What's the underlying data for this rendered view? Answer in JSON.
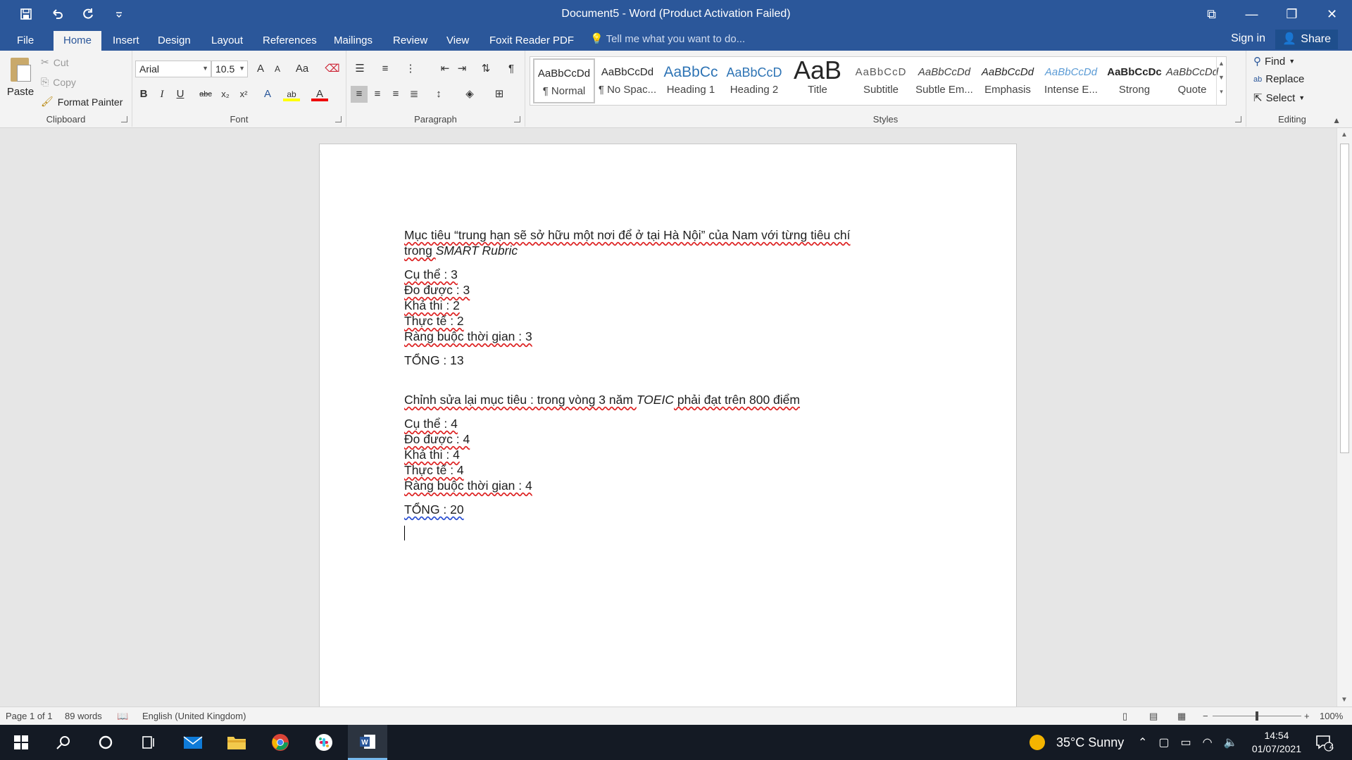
{
  "window": {
    "title": "Document5 - Word (Product Activation Failed)",
    "controls": [
      "⧉",
      "—",
      "❐",
      "✕"
    ]
  },
  "qat": {
    "icons": [
      "save-icon",
      "undo-icon",
      "redo-icon",
      "customize-icon"
    ]
  },
  "tabs": [
    "File",
    "Home",
    "Insert",
    "Design",
    "Layout",
    "References",
    "Mailings",
    "Review",
    "View",
    "Foxit Reader PDF"
  ],
  "active_tab": "Home",
  "tell_me": "Tell me what you want to do...",
  "account": {
    "sign_in": "Sign in",
    "share": "Share"
  },
  "clipboard": {
    "paste": "Paste",
    "cut": "Cut",
    "copy": "Copy",
    "format_painter": "Format Painter",
    "label": "Clipboard"
  },
  "font": {
    "family": "Arial",
    "size": "10.5",
    "label": "Font",
    "case_btn": "Aa",
    "grow": "A",
    "shrink": "A"
  },
  "paragraph": {
    "label": "Paragraph"
  },
  "styles": {
    "label": "Styles",
    "items": [
      {
        "sample": "AaBbCcDd",
        "name": "¶ Normal"
      },
      {
        "sample": "AaBbCcDd",
        "name": "¶ No Spac..."
      },
      {
        "sample": "AaBbCc",
        "name": "Heading 1"
      },
      {
        "sample": "AaBbCcD",
        "name": "Heading 2"
      },
      {
        "sample": "AaB",
        "name": "Title"
      },
      {
        "sample": "AaBbCcD",
        "name": "Subtitle"
      },
      {
        "sample": "AaBbCcDd",
        "name": "Subtle Em..."
      },
      {
        "sample": "AaBbCcDd",
        "name": "Emphasis"
      },
      {
        "sample": "AaBbCcDd",
        "name": "Intense E..."
      },
      {
        "sample": "AaBbCcDc",
        "name": "Strong"
      },
      {
        "sample": "AaBbCcDd",
        "name": "Quote"
      }
    ]
  },
  "editing": {
    "label": "Editing",
    "find": "Find",
    "replace": "Replace",
    "select": "Select"
  },
  "document": {
    "p1_a": "Mục tiêu “trung hạn sẽ sở hữu một nơi để ở tại Hà Nội” của Nam với từng tiêu chí",
    "p1_b": "trong ",
    "p1_italic": "SMART Rubric",
    "list1": [
      "Cụ thể : 3",
      "Đo được : 3",
      "Khả thi : 2",
      "Thực tế : 2",
      "Ràng buộc thời gian : 3"
    ],
    "total1": "TỔNG : 13",
    "p2_a": "Chỉnh sửa lại mục tiêu : trong vòng 3 năm ",
    "p2_italic": "TOEIC",
    "p2_b": " phải đạt trên 800 điểm",
    "list2": [
      "Cụ thể : 4",
      "Đo được : 4",
      "Khả thi : 4",
      "Thực tế : 4",
      "Ràng buộc thời gian : 4"
    ],
    "total2": "TỔNG : 20"
  },
  "status": {
    "page": "Page 1 of 1",
    "words": "89 words",
    "language": "English (United Kingdom)",
    "zoom": "100%",
    "zoom_minus": "−",
    "zoom_plus": "+"
  },
  "taskbar": {
    "weather": "35°C  Sunny",
    "time": "14:54",
    "date": "01/07/2021",
    "notifications": "4"
  },
  "colors": {
    "accent": "#2b579a",
    "spelling": "#dd2222",
    "grammar": "#2b4fd1"
  }
}
